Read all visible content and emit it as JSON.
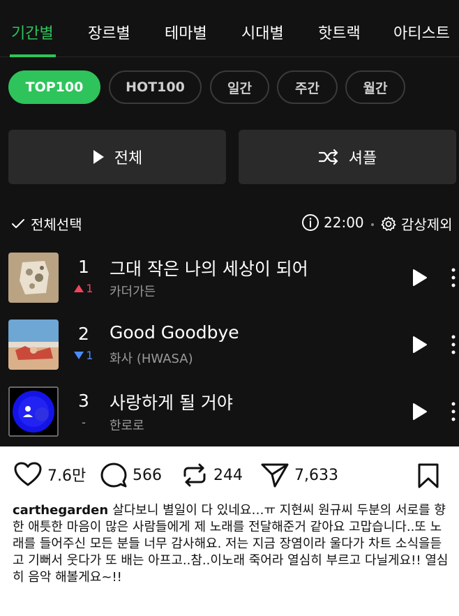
{
  "tabs": [
    {
      "label": "기간별",
      "active": true
    },
    {
      "label": "장르별",
      "active": false
    },
    {
      "label": "테마별",
      "active": false
    },
    {
      "label": "시대별",
      "active": false
    },
    {
      "label": "핫트랙",
      "active": false
    },
    {
      "label": "아티스트",
      "active": false
    }
  ],
  "filters": [
    {
      "label": "TOP100",
      "active": true
    },
    {
      "label": "HOT100",
      "active": false
    },
    {
      "label": "일간",
      "active": false
    },
    {
      "label": "주간",
      "active": false
    },
    {
      "label": "월간",
      "active": false
    }
  ],
  "actions": {
    "play_all": "전체",
    "shuffle": "셔플"
  },
  "list_header": {
    "select_all": "전체선택",
    "time": "22:00",
    "exclude": "감상제외"
  },
  "songs": [
    {
      "rank": "1",
      "change": "1",
      "change_dir": "up",
      "title": "그대 작은 나의 세상이 되어",
      "artist": "카더가든"
    },
    {
      "rank": "2",
      "change": "1",
      "change_dir": "down",
      "title": "Good Goodbye",
      "artist": "화사 (HWASA)"
    },
    {
      "rank": "3",
      "change": "-",
      "change_dir": "same",
      "title": "사랑하게 될 거야",
      "artist": "한로로"
    }
  ],
  "post": {
    "likes": "7.6만",
    "comments": "566",
    "reposts": "244",
    "shares": "7,633",
    "username": "carthegarden",
    "caption": "살다보니 별일이 다 있네요…ㅠ 지현씨 원규씨 두분의 서로를 향한 애틋한 마음이 많은 사람들에게 제 노래를 전달해준거 같아요 고맙습니다..또 노래를 들어주신 모든 분들 너무 감사해요. 저는 지금 장염이라 울다가 차트 소식을듣고 기뻐서 웃다가 또 배는 아프고..참..이노래 죽어라 열심히 부르고 다닐게요!! 열심히 음악 해볼게요~!!"
  },
  "colors": {
    "accent": "#2ec45b",
    "background": "#121212",
    "rank_up": "#f2435e",
    "rank_down": "#4a8cff"
  }
}
